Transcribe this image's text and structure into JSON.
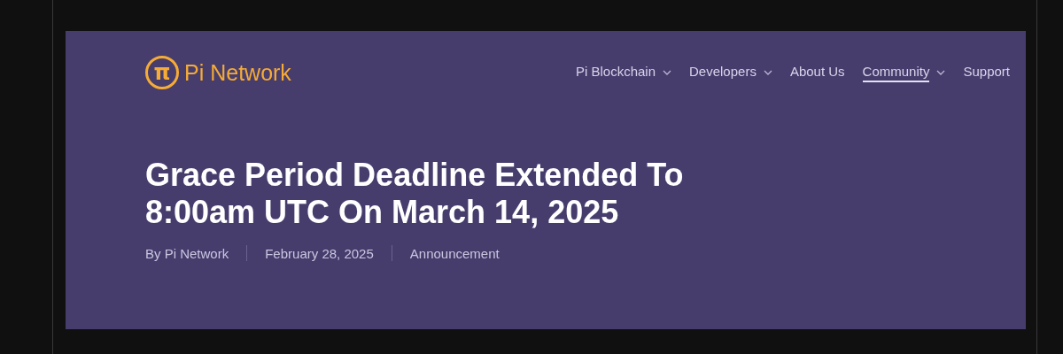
{
  "header": {
    "logo": {
      "glyph": "π",
      "name": "Pi Network"
    },
    "nav": [
      {
        "label": "Pi Blockchain",
        "kind": "dropdown",
        "selected": false
      },
      {
        "label": "Developers",
        "kind": "dropdown",
        "selected": false
      },
      {
        "label": "About Us",
        "kind": "link",
        "selected": false
      },
      {
        "label": "Community",
        "kind": "dropdown",
        "selected": true
      },
      {
        "label": "Support",
        "kind": "link",
        "selected": false
      }
    ]
  },
  "article": {
    "title": "Grace Period Deadline Extended To 8:00am UTC On March 14, 2025",
    "meta": [
      "By Pi Network",
      "February 28, 2025",
      "Announcement"
    ]
  }
}
